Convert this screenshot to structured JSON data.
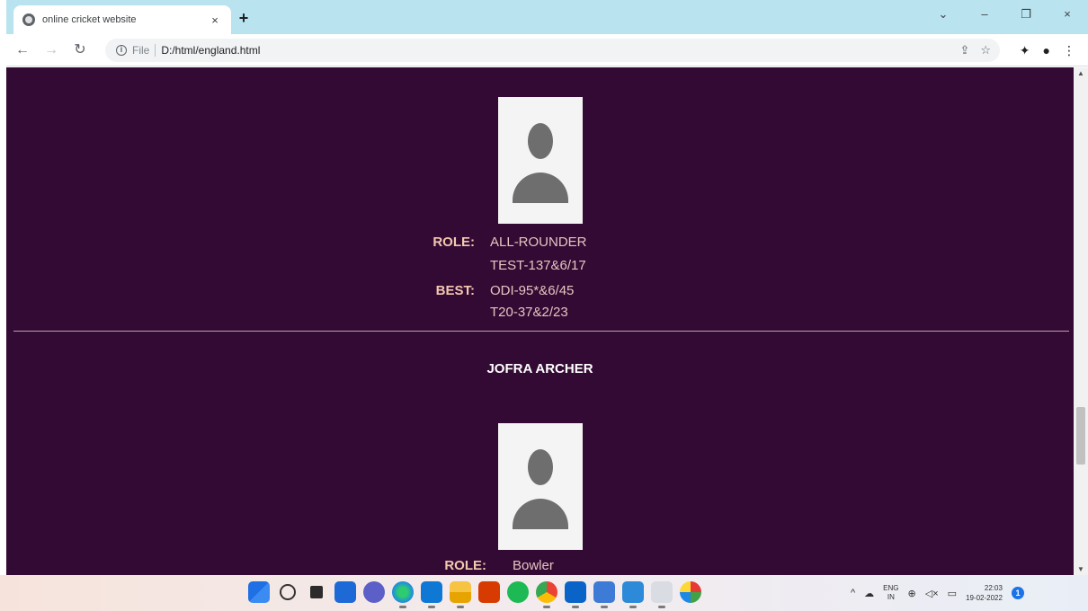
{
  "browser": {
    "tab_title": "online cricket website",
    "tab_close": "×",
    "new_tab": "+",
    "scheme": "File",
    "url": "D:/html/england.html",
    "window_controls": {
      "minimize": "–",
      "maximize": "❐",
      "close": "×",
      "dropdown": "⌄"
    }
  },
  "page": {
    "background": "#330a33",
    "player1": {
      "role_label": "ROLE:",
      "role_value": "ALL-ROUNDER",
      "best_label": "BEST:",
      "best_values": [
        "TEST-137&6/17",
        "ODI-95*&6/45",
        "T20-37&2/23"
      ]
    },
    "player2": {
      "name": "JOFRA ARCHER",
      "role_label": "ROLE:",
      "role_value": "Bowler"
    }
  },
  "taskbar": {
    "icons": [
      "start-icon",
      "search-icon",
      "task-view-icon",
      "widgets-icon",
      "chat-icon",
      "edge-icon",
      "store-icon",
      "file-explorer-icon",
      "office-icon",
      "spotify-icon",
      "chrome-icon",
      "mail-icon",
      "calculator-icon",
      "vscode-icon",
      "notepad-icon",
      "paint-icon"
    ],
    "lang_top": "ENG",
    "lang_bottom": "IN",
    "time": "22:03",
    "date": "19-02-2022",
    "badge": "1"
  }
}
